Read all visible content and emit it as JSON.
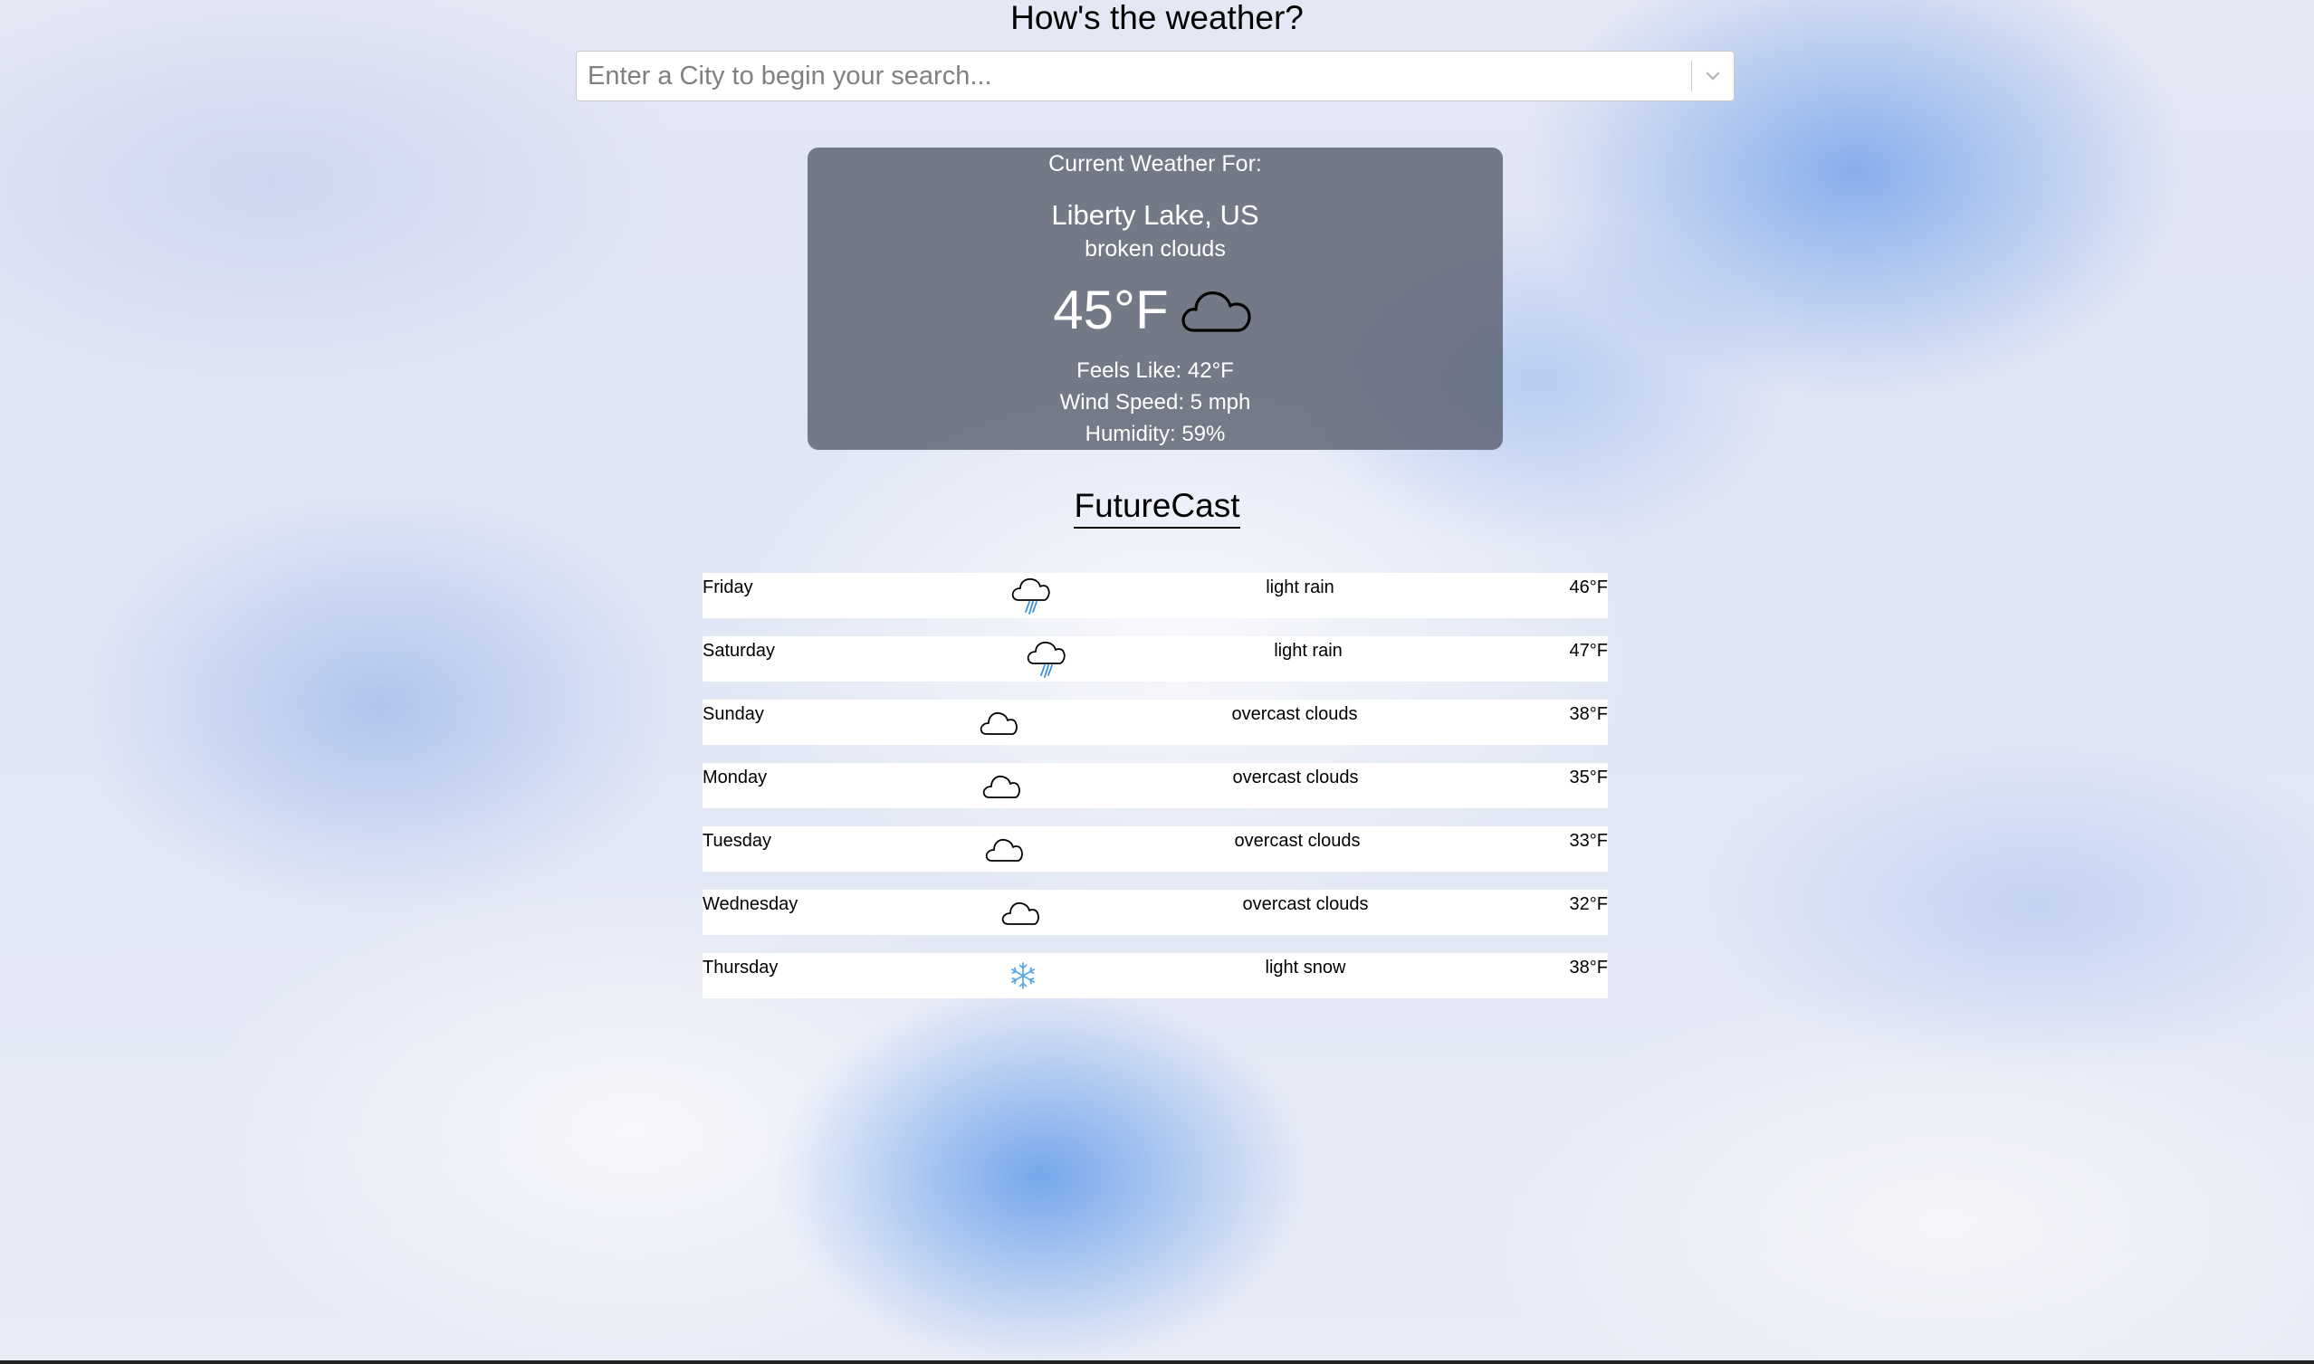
{
  "header": {
    "title": "How's the weather?"
  },
  "search": {
    "placeholder": "Enter a City to begin your search..."
  },
  "current": {
    "label": "Current Weather For:",
    "city": "Liberty Lake, US",
    "description": "broken clouds",
    "temperature": "45°F",
    "icon": "cloud-icon",
    "feels_like": "Feels Like: 42°F",
    "wind_speed": "Wind Speed: 5 mph",
    "humidity": "Humidity: 59%"
  },
  "forecast": {
    "title": "FutureCast",
    "days": [
      {
        "day": "Friday",
        "icon": "rain-icon",
        "description": "light rain",
        "temp": "46°F"
      },
      {
        "day": "Saturday",
        "icon": "rain-icon",
        "description": "light rain",
        "temp": "47°F"
      },
      {
        "day": "Sunday",
        "icon": "cloud-icon",
        "description": "overcast clouds",
        "temp": "38°F"
      },
      {
        "day": "Monday",
        "icon": "cloud-icon",
        "description": "overcast clouds",
        "temp": "35°F"
      },
      {
        "day": "Tuesday",
        "icon": "cloud-icon",
        "description": "overcast clouds",
        "temp": "33°F"
      },
      {
        "day": "Wednesday",
        "icon": "cloud-icon",
        "description": "overcast clouds",
        "temp": "32°F"
      },
      {
        "day": "Thursday",
        "icon": "snowflake-icon",
        "description": "light snow",
        "temp": "38°F"
      }
    ]
  },
  "colors": {
    "card_background": "#555a69",
    "rain_accent": "#3a8fd6",
    "snow_accent": "#5aa9e6"
  }
}
